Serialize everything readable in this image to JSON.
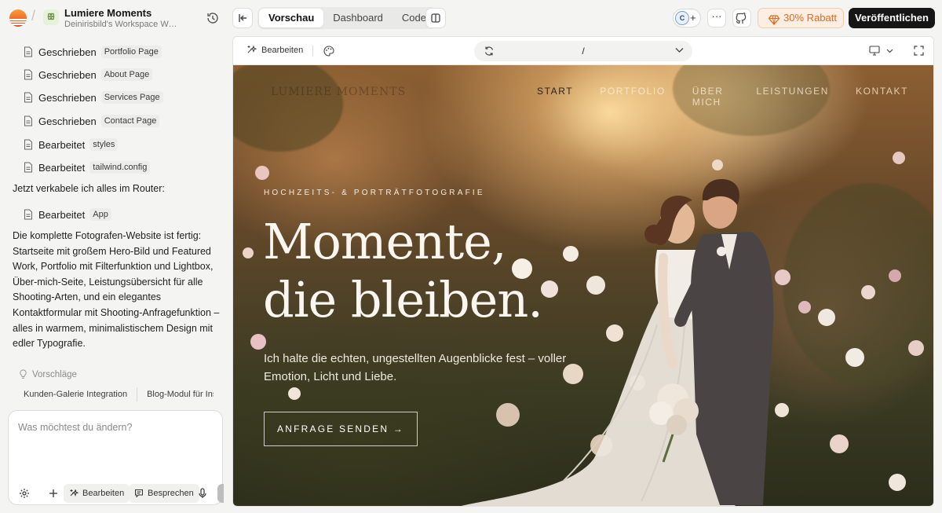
{
  "header": {
    "project_title": "Lumiere Moments",
    "project_subtitle": "Deinirisbild's Workspace Wor...",
    "project_badge": "ꕥ",
    "tabs": [
      "Vorschau",
      "Dashboard",
      "Code"
    ],
    "active_tab": "Vorschau",
    "collaborator_initial": "C",
    "add_collaborator": "+",
    "more": "···",
    "promo_label": "30% Rabatt",
    "publish_label": "Veröffentlichen"
  },
  "chat": {
    "file_actions": [
      {
        "action": "Geschrieben",
        "file": "Portfolio Page"
      },
      {
        "action": "Geschrieben",
        "file": "About Page"
      },
      {
        "action": "Geschrieben",
        "file": "Services Page"
      },
      {
        "action": "Geschrieben",
        "file": "Contact Page"
      },
      {
        "action": "Bearbeitet",
        "file": "styles"
      },
      {
        "action": "Bearbeitet",
        "file": "tailwind.config"
      }
    ],
    "router_message": "Jetzt verkabele ich alles im Router:",
    "router_action": {
      "action": "Bearbeitet",
      "file": "App"
    },
    "summary_message": "Die komplette Fotografen-Website ist fertig: Startseite mit großem Hero-Bild und Featured Work, Portfolio mit Filterfunktion und Lightbox, Über-mich-Seite, Leistungsübersicht für alle Shooting-Arten, und ein elegantes Kontaktformular mit Shooting-Anfragefunktion – alles in warmem, minimalistischem Design mit edler Typografie.",
    "suggestions_label": "Vorschläge",
    "suggestions": [
      "Kunden-Galerie Integration",
      "Blog-Modul für Inspiration"
    ],
    "composer": {
      "placeholder": "Was möchtest du ändern?",
      "value": "",
      "edit_label": "Bearbeiten",
      "discuss_label": "Besprechen"
    }
  },
  "preview": {
    "edit_label": "Bearbeiten",
    "url_path": "/",
    "site": {
      "nav_logo": "LUMIERE MOMENTS",
      "nav": [
        "START",
        "PORTFOLIO",
        "ÜBER MICH",
        "LEISTUNGEN",
        "KONTAKT"
      ],
      "active_nav": "START",
      "eyebrow": "HOCHZEITS- & PORTRÄTFOTOGRAFIE",
      "title_line1": "Momente,",
      "title_line2": "die bleiben.",
      "subtitle": "Ich halte die echten, ungestellten Augenblicke fest – voller Emotion, Licht und Liebe.",
      "cta_label": "ANFRAGE SENDEN →"
    }
  },
  "colors": {
    "brand_orange": "#f26b2a",
    "promo_text": "#e46b1f",
    "publish_bg": "#161616",
    "hero_text": "#fbf7f0"
  }
}
